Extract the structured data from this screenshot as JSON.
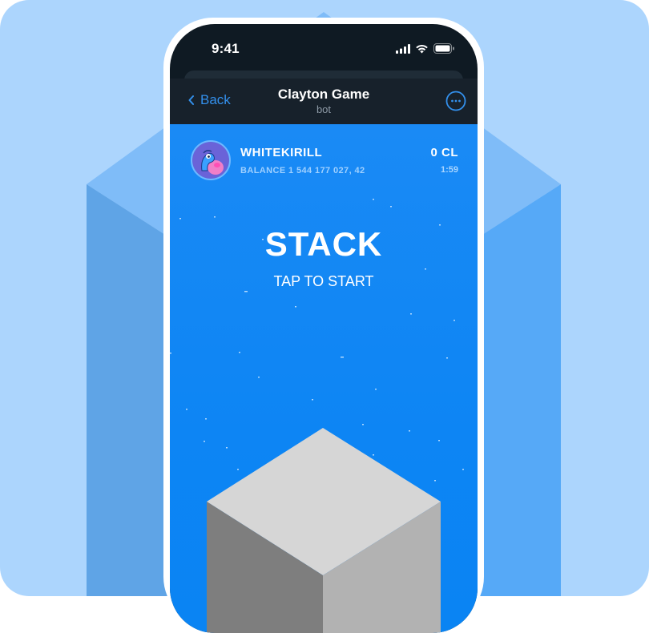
{
  "status_bar": {
    "time": "9:41"
  },
  "header": {
    "back_label": "Back",
    "title": "Clayton Game",
    "subtitle": "bot"
  },
  "game": {
    "username": "WHITEKIRILL",
    "balance": "BALANCE 1 544 177 027, 42",
    "score": "0 CL",
    "timer": "1:59",
    "title": "STACK",
    "instruction": "TAP TO START"
  },
  "icons": {
    "back": "chevron-left-icon",
    "more": "more-circle-icon",
    "signal": "cellular-signal-icon",
    "wifi": "wifi-icon",
    "battery": "battery-icon"
  },
  "colors": {
    "background": "#acd5fd",
    "telegram_header": "#17212b",
    "telegram_accent": "#3390ec",
    "game_blue": "#0d85f4",
    "block_top": "#d6d6d6",
    "block_left": "#7e7e7e",
    "block_right": "#b2b2b2"
  }
}
